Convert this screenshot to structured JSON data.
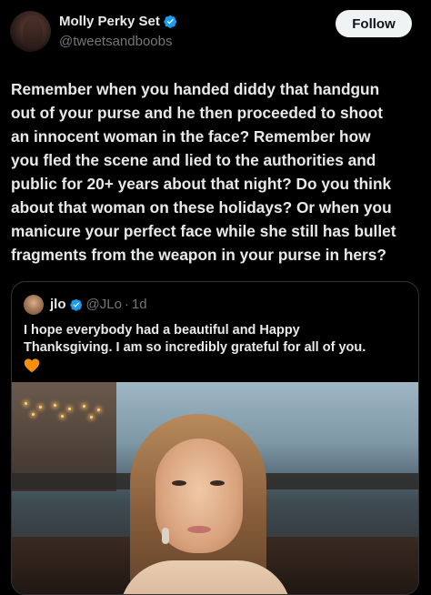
{
  "author": {
    "display_name": "Molly Perky Set",
    "handle": "@tweetsandboobs",
    "verified_icon": "verified-badge-icon",
    "badge_color": "#1d9bf0"
  },
  "follow_button": {
    "label": "Follow"
  },
  "tweet": {
    "text": "Remember when you handed diddy that handgun\nout of your purse and he then proceeded to shoot\nan innocent woman in the face?  Remember how\nyou fled the scene and lied to the authorities and\npublic for 20+ years about that night? Do you think\nabout that woman on these holidays? Or when you\nmanicure your perfect face while she still has bullet\nfragments from the weapon in your purse in hers?"
  },
  "quoted_tweet": {
    "display_name": "jlo",
    "handle": "@JLo",
    "separator": "·",
    "time": "1d",
    "text": "I hope everybody had a beautiful and Happy\nThanksgiving. I am so incredibly grateful for all of you.",
    "emoji_icon": "orange-heart-icon",
    "emoji_color": "#f4900c",
    "media": {
      "description_icon": "photo-image"
    }
  }
}
